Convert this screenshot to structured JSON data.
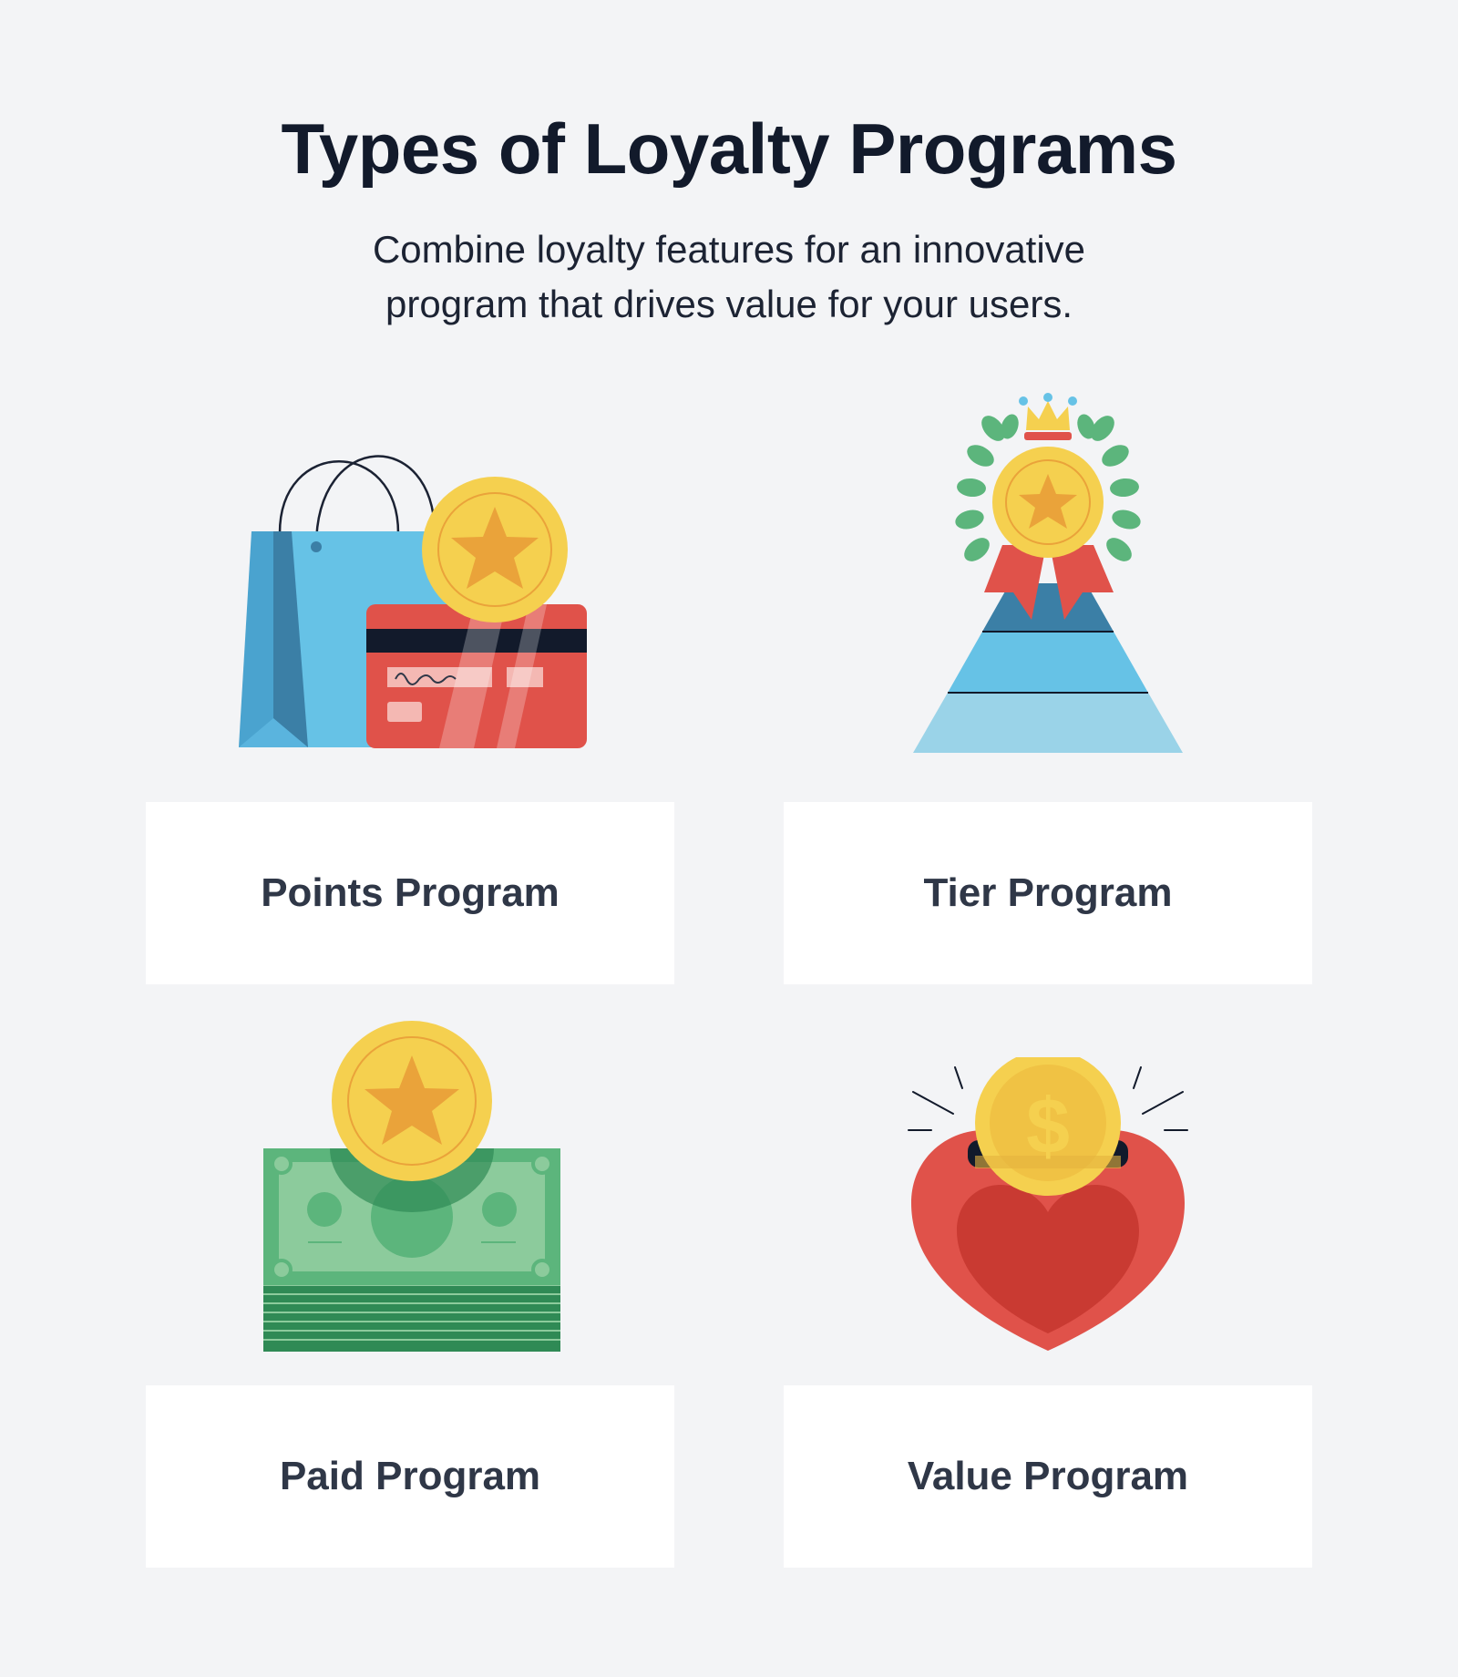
{
  "header": {
    "title": "Types of Loyalty Programs",
    "subtitle_line1": "Combine loyalty features for an innovative",
    "subtitle_line2": "program that drives value for your users."
  },
  "programs": [
    {
      "label": "Points Program",
      "icon": "shopping-bag-card-coin-icon"
    },
    {
      "label": "Tier Program",
      "icon": "pyramid-medal-laurel-icon"
    },
    {
      "label": "Paid Program",
      "icon": "cash-stack-coin-icon"
    },
    {
      "label": "Value Program",
      "icon": "heart-piggy-bank-coin-icon"
    }
  ],
  "colors": {
    "background": "#f3f4f6",
    "title": "#121a2b",
    "card": "#ffffff",
    "label": "#2f3747",
    "coin": "#f5d04f",
    "star": "#eaa33a",
    "red": "#e0524a",
    "blue": "#66c2e6",
    "green": "#5cb57c"
  }
}
